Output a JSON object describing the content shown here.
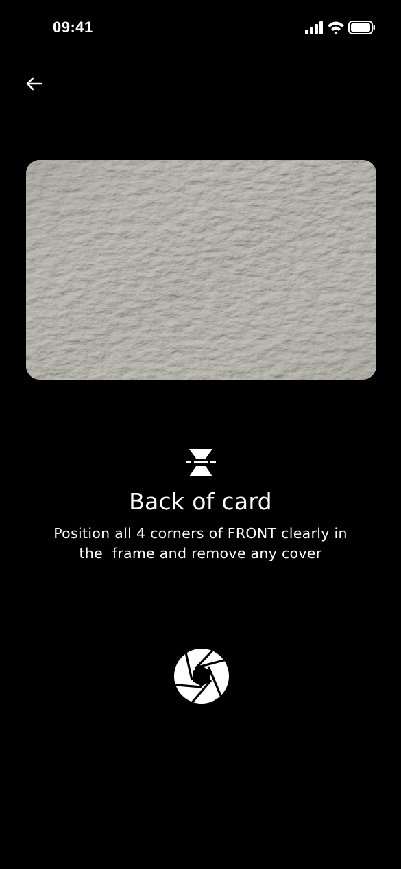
{
  "status_bar": {
    "time": "09:41",
    "icons": [
      "signal-icon",
      "wifi-icon",
      "battery-icon"
    ]
  },
  "header": {
    "back_icon": "arrow-left-icon"
  },
  "card_preview": {
    "surface_color": "#a9a79f"
  },
  "instruction": {
    "icon": "card-flip-icon",
    "title": "Back of card",
    "text": "Position all 4 corners of FRONT clearly in\nthe  frame and remove any cover"
  },
  "capture": {
    "icon": "camera-shutter-icon"
  },
  "colors": {
    "background": "#000000",
    "foreground": "#ffffff"
  }
}
